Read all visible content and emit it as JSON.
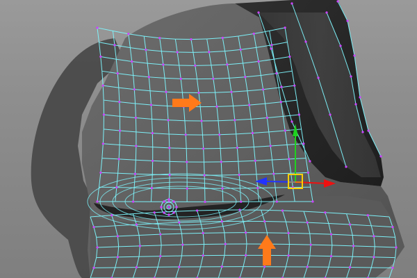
{
  "viewport": {
    "type": "3d-viewport",
    "mesh": "polygon-head-wireframe",
    "background_color": "#8f8f8f",
    "mesh_base_color": "#5f5f5f",
    "wire_color": "#7ff7ff",
    "vertex_color": "#cc44ff",
    "accent_color": "#ff7a1a"
  },
  "icons": {
    "move_manip": "move-manipulator-icon",
    "x_axis": "x-axis-arrow-icon",
    "y_axis": "y-axis-arrow-icon",
    "z_axis": "z-axis-arrow-icon",
    "annotation_right": "orange-arrow-right-icon",
    "annotation_up": "orange-arrow-up-icon"
  }
}
